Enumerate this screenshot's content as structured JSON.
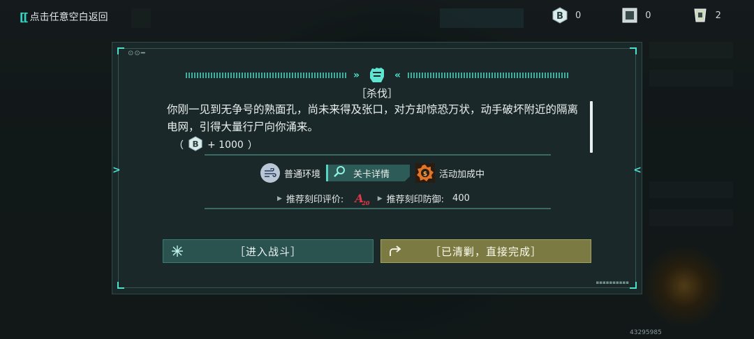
{
  "topbar": {
    "back_label": "点击任意空白返回",
    "resources": [
      {
        "icon": "coin-b-icon",
        "value": "0"
      },
      {
        "icon": "chip-icon",
        "value": "0"
      },
      {
        "icon": "ticket-icon",
        "value": "2"
      }
    ]
  },
  "dialog": {
    "title": "［杀伐］",
    "story": "你刚一见到无争号的熟面孔，尚未来得及张口，对方却惊恐万状，动手破坏附近的隔离电网，引得大量行尸向你涌来。",
    "reward": {
      "open": "（",
      "amount": "+ 1000",
      "close": "）",
      "icon": "coin-b-icon"
    },
    "tags": {
      "environment": "普通环境",
      "detail": "关卡详情",
      "bonus": "活动加成中"
    },
    "recommend": {
      "rating_label": "推荐刻印评价:",
      "rating_value": "A",
      "rating_sub": "20",
      "defense_label": "推荐刻印防御:",
      "defense_value": "400"
    },
    "buttons": {
      "fight": "［进入战斗］",
      "clear": "［已清剿，直接完成］"
    }
  },
  "uid": "43295985",
  "colors": {
    "accent": "#4de0cd",
    "fight_bg": "#2a524f",
    "clear_bg": "#7b7a42",
    "grade": "#e5384c"
  }
}
